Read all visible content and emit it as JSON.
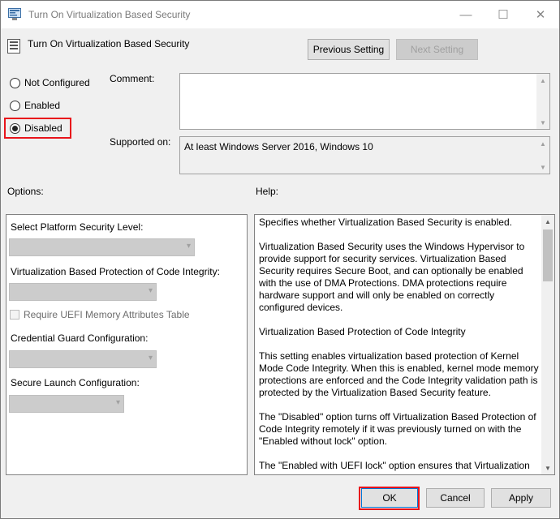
{
  "window": {
    "title": "Turn On Virtualization Based Security",
    "minimize_glyph": "—",
    "maximize_glyph": "☐",
    "close_glyph": "✕"
  },
  "header": {
    "policy_name": "Turn On Virtualization Based Security",
    "previous_setting": "Previous Setting",
    "next_setting": "Next Setting"
  },
  "state": {
    "not_configured": "Not Configured",
    "enabled": "Enabled",
    "disabled": "Disabled",
    "selected": "Disabled"
  },
  "comment": {
    "label": "Comment:",
    "value": ""
  },
  "supported": {
    "label": "Supported on:",
    "value": "At least Windows Server 2016, Windows 10"
  },
  "options": {
    "heading": "Options:",
    "platform_security_label": "Select Platform Security Level:",
    "platform_security_value": "",
    "code_integrity_label": "Virtualization Based Protection of Code Integrity:",
    "code_integrity_value": "",
    "uefi_memory_label": "Require UEFI Memory Attributes Table",
    "credential_guard_label": "Credential Guard Configuration:",
    "credential_guard_value": "",
    "secure_launch_label": "Secure Launch Configuration:",
    "secure_launch_value": ""
  },
  "help": {
    "heading": "Help:",
    "paragraphs": [
      "Specifies whether Virtualization Based Security is enabled.",
      "Virtualization Based Security uses the Windows Hypervisor to provide support for security services. Virtualization Based Security requires Secure Boot, and can optionally be enabled with the use of DMA Protections. DMA protections require hardware support and will only be enabled on correctly configured devices.",
      "Virtualization Based Protection of Code Integrity",
      "This setting enables virtualization based protection of Kernel Mode Code Integrity. When this is enabled, kernel mode memory protections are enforced and the Code Integrity validation path is protected by the Virtualization Based Security feature.",
      "The \"Disabled\" option turns off Virtualization Based Protection of Code Integrity remotely if it was previously turned on with the \"Enabled without lock\" option.",
      "The \"Enabled with UEFI lock\" option ensures that Virtualization"
    ]
  },
  "footer": {
    "ok": "OK",
    "cancel": "Cancel",
    "apply": "Apply"
  },
  "colors": {
    "highlight": "#e8141b",
    "window_bg": "#f0f0f0"
  }
}
